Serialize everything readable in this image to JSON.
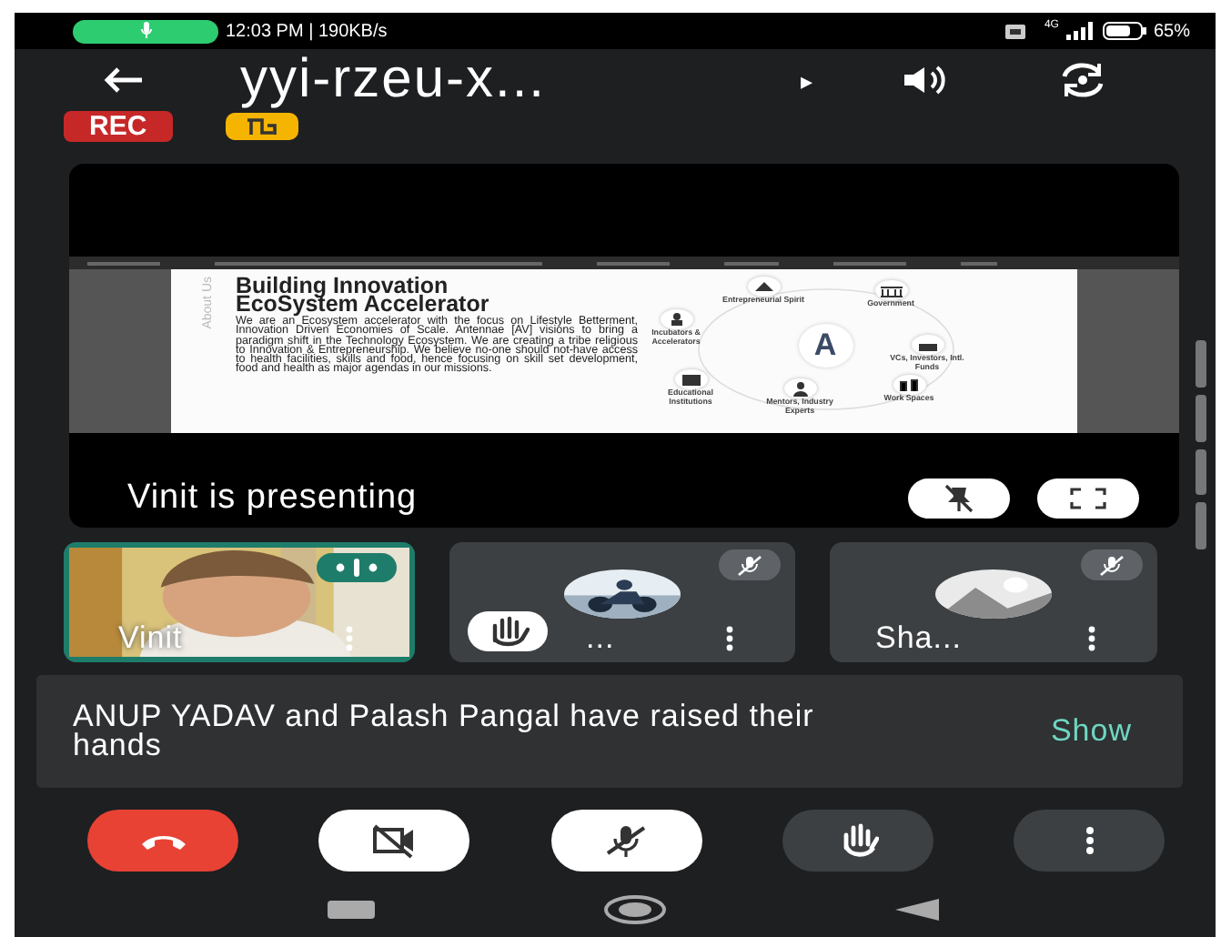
{
  "status_bar": {
    "time": "12:03 PM | 190KB/s",
    "network": "4G",
    "battery": "65%"
  },
  "header": {
    "title": "yyi-rzeu-x...",
    "expand": "▸"
  },
  "badges": {
    "recording": "REC"
  },
  "presentation": {
    "slide": {
      "side_label": "About Us",
      "title": "Building Innovation EcoSystem Accelerator",
      "body": "We are an Ecosystem accelerator with the focus on Lifestyle Betterment, Innovation Driven Economies of Scale. Antennae [AV] visions to bring a paradigm shift in the Technology Ecosystem. We are creating a tribe religious to Innovation & Entrepreneurship. We believe no-one should not-have access to health facilities, skills and food, hence focusing on skill set development, food and health as major agendas in our missions.",
      "hub": "A",
      "nodes": [
        {
          "label": "Entrepreneurial Spirit"
        },
        {
          "label": "Government"
        },
        {
          "label": "Incubators & Accelerators"
        },
        {
          "label": "VCs, Investors, Intl. Funds"
        },
        {
          "label": "Educational Institutions"
        },
        {
          "label": "Mentors, Industry Experts"
        },
        {
          "label": "Work Spaces"
        }
      ]
    },
    "caption": "Vinit is presenting"
  },
  "participants": [
    {
      "name": "Vinit",
      "kind": "video",
      "speaking": true,
      "muted": false,
      "hand_raised": false
    },
    {
      "name": "...",
      "kind": "avatar",
      "speaking": false,
      "muted": true,
      "hand_raised": true
    },
    {
      "name": "Sha...",
      "kind": "avatar",
      "speaking": false,
      "muted": true,
      "hand_raised": false
    }
  ],
  "notification": {
    "text": "ANUP YADAV and Palash Pangal have raised their hands",
    "action": "Show"
  },
  "controls": [
    {
      "kind": "leave"
    },
    {
      "kind": "camera",
      "on": false
    },
    {
      "kind": "mic",
      "on": false
    },
    {
      "kind": "hand",
      "on": false
    },
    {
      "kind": "more"
    }
  ]
}
